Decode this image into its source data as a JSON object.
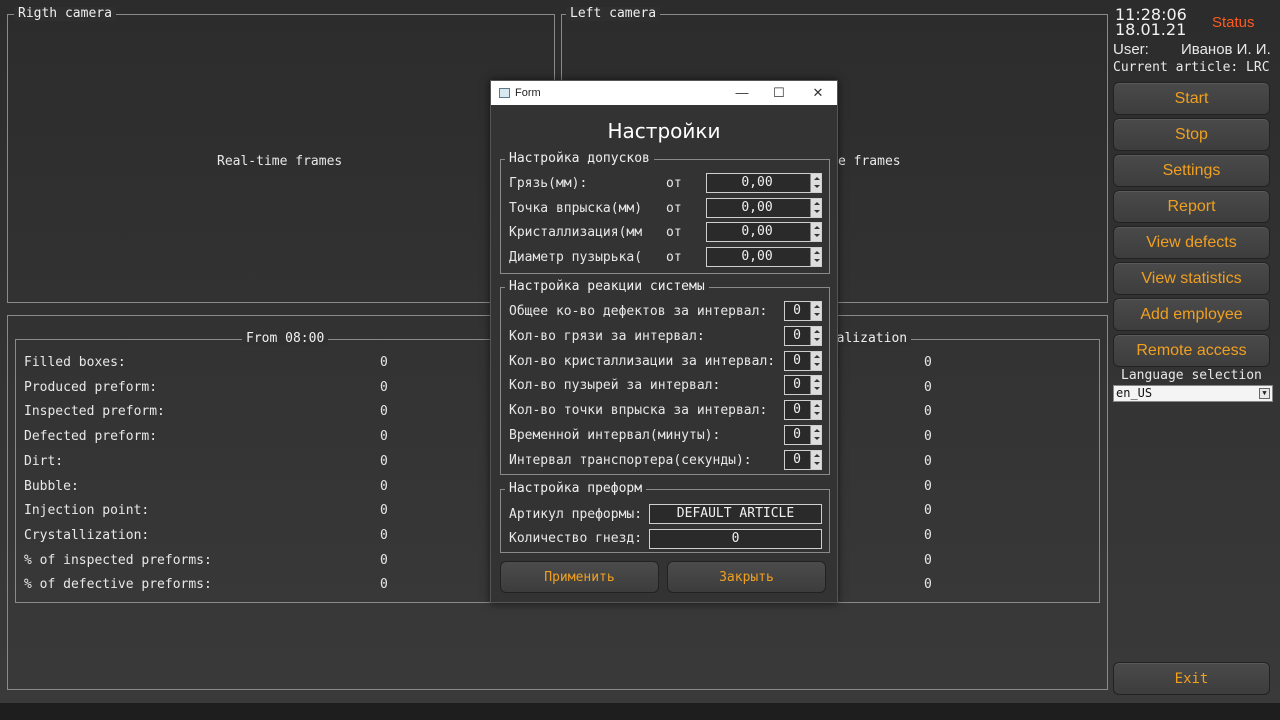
{
  "cameras": {
    "right_title": "Rigth camera",
    "left_title": "Left camera",
    "right_text": "Real-time frames",
    "left_text": "e frames"
  },
  "stats": {
    "left_title": "From 08:00",
    "right_title_partial": "tialization",
    "labels": [
      "Filled boxes:",
      "Produced preform:",
      "Inspected preform:",
      "Defected preform:",
      "Dirt:",
      "Bubble:",
      "Injection point:",
      "Crystallization:",
      "% of inspected preforms:",
      "% of defective preforms:"
    ],
    "left_values": [
      "0",
      "0",
      "0",
      "0",
      "0",
      "0",
      "0",
      "0",
      "0",
      "0"
    ],
    "right_values": [
      "0",
      "0",
      "0",
      "0",
      "0",
      "0",
      "0",
      "0",
      "0",
      "0"
    ]
  },
  "header": {
    "time": "11:28:06",
    "date": "18.01.21",
    "status": "Status",
    "user_label": "User:",
    "user_name": "Иванов И. И.",
    "article": "Current article: LRC"
  },
  "menu": {
    "buttons": [
      "Start",
      "Stop",
      "Settings",
      "Report",
      "View defects",
      "View statistics",
      "Add employee",
      "Remote access"
    ],
    "language_label": "Language selection",
    "language_value": "en_US",
    "exit": "Exit"
  },
  "colors": {
    "accent": "#f0a020",
    "status": "#ff5a1f"
  },
  "modal": {
    "window_title": "Form",
    "heading": "Настройки",
    "tolerances": {
      "title": "Настройка допусков",
      "rows": [
        {
          "label": "Грязь(мм):",
          "from": "от",
          "value": "0,00"
        },
        {
          "label": "Точка впрыска(мм)",
          "from": "от",
          "value": "0,00"
        },
        {
          "label": "Кристаллизация(мм",
          "from": "от",
          "value": "0,00"
        },
        {
          "label": "Диаметр пузырька(",
          "from": "от",
          "value": "0,00"
        }
      ]
    },
    "reaction": {
      "title": "Настройка реакции системы",
      "rows": [
        {
          "label": "Общее ко-во дефектов за интервал:",
          "value": "0"
        },
        {
          "label": "Кол-во грязи за интервал:",
          "value": "0"
        },
        {
          "label": "Кол-во кристаллизации за интервал:",
          "value": "0"
        },
        {
          "label": "Кол-во пузырей за интервал:",
          "value": "0"
        },
        {
          "label": "Кол-во точки впрыска за интервал:",
          "value": "0"
        },
        {
          "label": "Временной интервал(минуты):",
          "value": "0"
        },
        {
          "label": "Интервал транспортера(секунды):",
          "value": "0"
        }
      ]
    },
    "preform": {
      "title": "Настройка преформ",
      "article_label": "Артикул преформы:",
      "article_value": "DEFAULT ARTICLE",
      "sockets_label": "Количество гнезд:",
      "sockets_value": "0"
    },
    "apply": "Применить",
    "close": "Закрыть"
  }
}
